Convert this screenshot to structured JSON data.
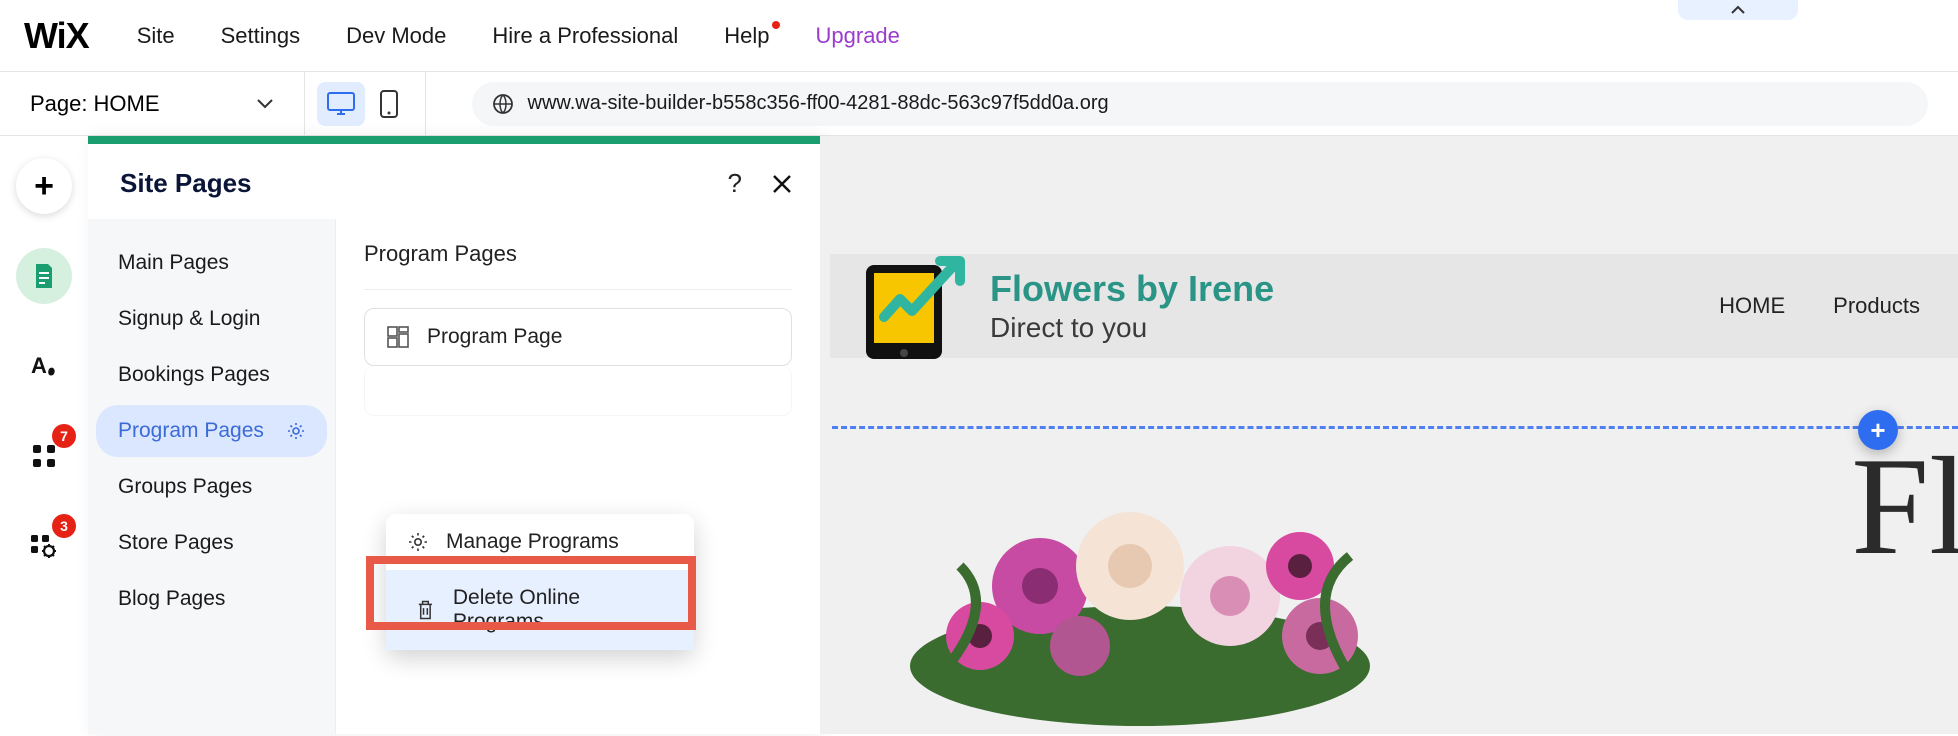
{
  "topbar": {
    "logo": "WiX",
    "menu": [
      "Site",
      "Settings",
      "Dev Mode",
      "Hire a Professional",
      "Help",
      "Upgrade"
    ]
  },
  "secbar": {
    "page_label": "Page:",
    "page_name": "HOME",
    "url": "www.wa-site-builder-b558c356-ff00-4281-88dc-563c97f5dd0a.org"
  },
  "rail": {
    "badges": {
      "apps": "7",
      "settings": "3"
    }
  },
  "panel": {
    "title": "Site Pages",
    "categories": [
      "Main Pages",
      "Signup & Login",
      "Bookings Pages",
      "Program Pages",
      "Groups Pages",
      "Store Pages",
      "Blog Pages"
    ],
    "active_category_index": 3,
    "section_title": "Program Pages",
    "page_row": "Program Page"
  },
  "ctx": {
    "manage": "Manage Programs",
    "delete": "Delete Online Programs"
  },
  "site": {
    "title": "Flowers by Irene",
    "subtitle": "Direct to you",
    "nav": [
      "HOME",
      "Products"
    ],
    "hero": "Fl"
  }
}
